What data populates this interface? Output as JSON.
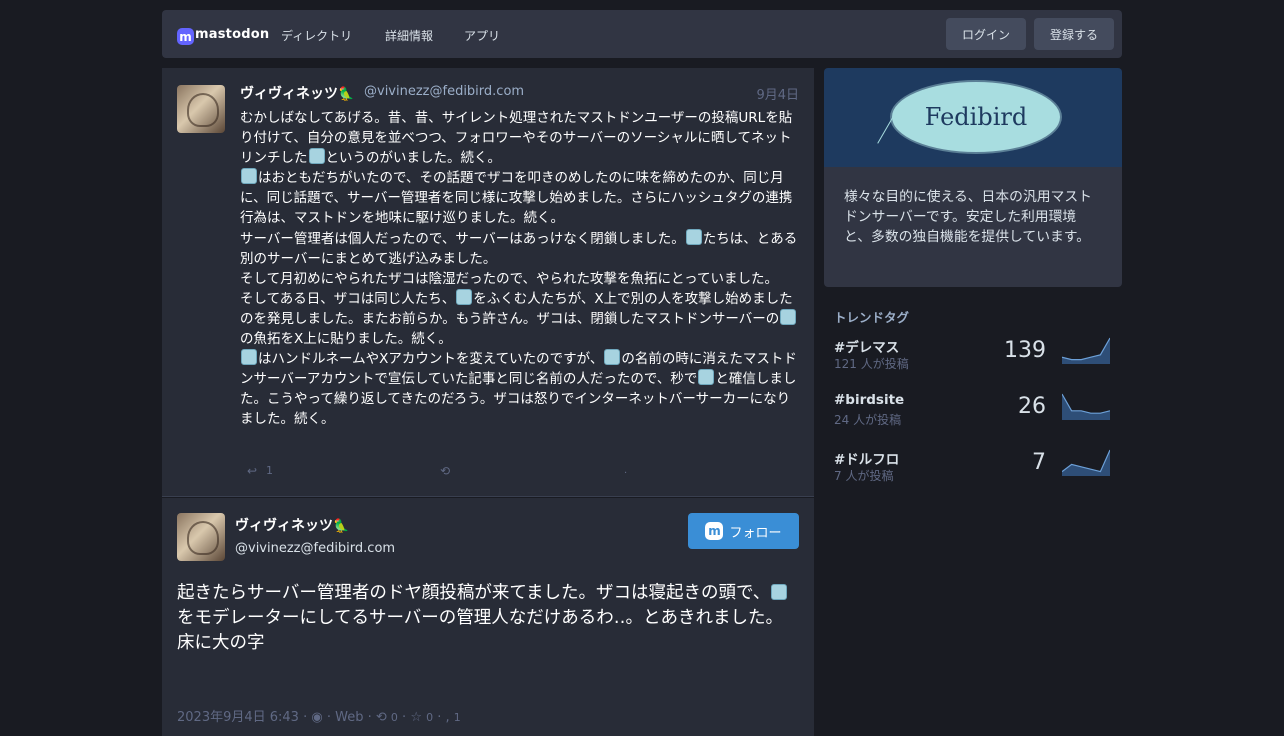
{
  "header": {
    "logo_text": "mastodon",
    "logo_glyph": "m",
    "nav": [
      "ディレクトリ",
      "詳細情報",
      "アプリ"
    ],
    "login_label": "ログイン",
    "signup_label": "登録する"
  },
  "post1": {
    "display_name": "ヴィヴィネッツ",
    "name_emoji": "🦜",
    "account": "@vivinezz@fedibird.com",
    "date": "9月4日",
    "lines": [
      [
        "むかしばなしてあげる。昔、昔、サイレント処理されたマストドンユーザーの投稿URLを貼り付けて、自分の意見を並べつつ、フォロワーやそのサーバーのソーシャルに晒してネットリンチした",
        "emoji",
        "というのがいました。続く。"
      ],
      [
        "emoji",
        "はおともだちがいたので、その話題でザコを叩きのめしたのに味を締めたのか、同じ月に、同じ話題で、サーバー管理者を同じ様に攻撃し始めました。さらにハッシュタグの連携行為は、マストドンを地味に駆け巡りました。続く。"
      ],
      [
        "サーバー管理者は個人だったので、サーバーはあっけなく閉鎖しました。",
        "emoji",
        "たちは、とある別のサーバーにまとめて逃げ込みました。"
      ],
      [
        "そして月初めにやられたザコは陰湿だったので、やられた攻撃を魚拓にとっていました。"
      ],
      [
        "そしてある日、ザコは同じ人たち、",
        "emoji",
        "をふくむ人たちが、X上で別の人を攻撃し始めましたのを発見しました。またお前らか。もう許さん。ザコは、閉鎖したマストドンサーバーの",
        "emoji",
        "の魚拓をX上に貼りました。続く。"
      ],
      [
        "emoji",
        "はハンドルネームやXアカウントを変えていたのですが、",
        "emoji",
        "の名前の時に消えたマストドンサーバーアカウントで宣伝していた記事と同じ名前の人だったので、秒で",
        "emoji",
        "と確信しました。こうやって繰り返してきたのだろう。ザコは怒りでインターネットバーサーカーになりました。続く。"
      ]
    ],
    "reply_count": "1"
  },
  "post2": {
    "display_name": "ヴィヴィネッツ",
    "name_emoji": "🦜",
    "account": "@vivinezz@fedibird.com",
    "follow_label": "フォロー",
    "follow_glyph": "m",
    "body_lines": [
      [
        "起きたらサーバー管理者のドヤ顔投稿が来てました。ザコは寝起きの頭で、",
        "emoji",
        "をモデレーターにしてるサーバーの管理人なだけあるわ‥。とあきれました。"
      ],
      [
        "床に大の字"
      ]
    ],
    "meta": {
      "timestamp": "2023年9月4日 6:43",
      "app": "Web",
      "boosts": "0",
      "favs": "0",
      "replies": "1"
    }
  },
  "sidebar": {
    "hero_text": "Fedibird",
    "description": "様々な目的に使える、日本の汎用マストドンサーバーです。安定した利用環境と、多数の独自機能を提供しています。",
    "trends_title": "トレンドタグ",
    "trends": [
      {
        "tag": "#デレマス",
        "uses": "121 人が投稿",
        "count": "139",
        "spark": [
          2,
          1,
          1,
          2,
          3,
          10
        ]
      },
      {
        "tag": "#birdsite",
        "uses": "24 人が投稿",
        "count": "26",
        "spark": [
          10,
          3,
          3,
          2,
          2,
          3
        ]
      },
      {
        "tag": "#ドルフロ",
        "uses": "7 人が投稿",
        "count": "7",
        "spark": [
          1,
          4,
          3,
          2,
          1,
          10
        ]
      }
    ]
  },
  "colors": {
    "background": "#191b22",
    "card": "#282c37",
    "header": "#313543",
    "accent": "#3a8ed6",
    "muted": "#606984"
  }
}
